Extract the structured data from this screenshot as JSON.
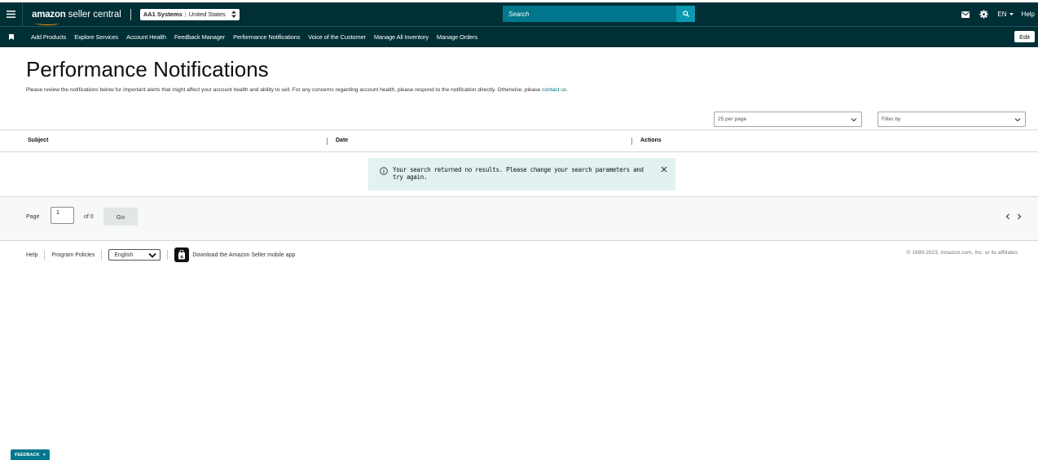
{
  "topbar": {
    "logo_brand": "amazon",
    "logo_product": "seller central",
    "account_name": "AA1 Systems",
    "account_marketplace": "United States",
    "search_placeholder": "Search",
    "language": "EN",
    "help": "Help"
  },
  "nav": {
    "items": [
      "Add Products",
      "Explore Services",
      "Account Health",
      "Feedback Manager",
      "Performance Notifications",
      "Voice of the Customer",
      "Manage All Inventory",
      "Manage Orders"
    ],
    "edit": "Edit"
  },
  "page": {
    "title": "Performance Notifications",
    "description": "Please review the notifications below for important alerts that might affect your account health and ability to sell. For any concerns regarding account health, please respond to the notification directly. Otherwise, please ",
    "contact_link": "contact us",
    "description_end": "."
  },
  "filters": {
    "per_page": "25 per page",
    "filter_by": "Filter by"
  },
  "table": {
    "columns": [
      "Subject",
      "Date",
      "Actions"
    ],
    "rows": [],
    "empty_message": "Your search returned no results. Please change your search parameters and try again."
  },
  "pagination": {
    "page_label": "Page",
    "page_value": "1",
    "of_label": "of 0",
    "go": "Go"
  },
  "footer": {
    "help": "Help",
    "program_policies": "Program Policies",
    "language": "English",
    "app_download": "Download the Amazon Seller mobile app",
    "copyright": "© 1999-2023, Amazon.com, Inc. or its affiliates"
  },
  "feedback": {
    "label": "FEEDBACK",
    "close": "×"
  },
  "colors": {
    "header_bg": "#002f36",
    "search_bg": "#00778c",
    "link": "#007185",
    "alert_bg": "#e3f1f2",
    "logo_accent": "#ff9900"
  }
}
